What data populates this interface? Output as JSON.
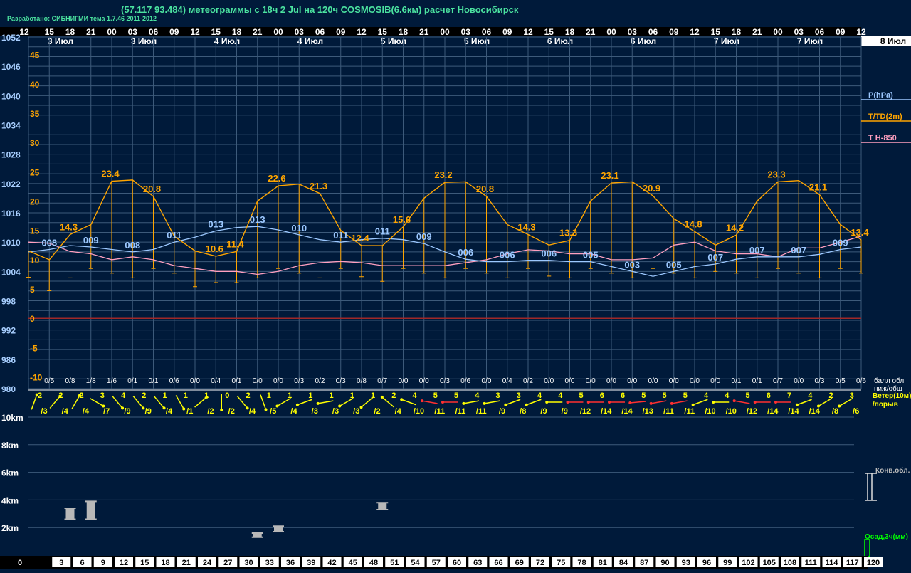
{
  "header": {
    "title": "(57.117 93.484) метеограммы с  18ч 2 Jul на 120ч COSMOSIB(6.6км) расчет Новосибирск",
    "subtitle": "Разработано: СИБНИГМИ тема 1.7.46 2011-2012"
  },
  "colors": {
    "background": "#001a3a",
    "grid": "#3d5a7a",
    "pressure": "#9cc8ff",
    "temperature": "#ffa500",
    "t850": "#ffa0c0",
    "wind": "#ffff00",
    "wind_strong": "#ff3030",
    "zero_line": "#a02828",
    "cloud": "#b8b8b8",
    "precip": "#00ff00"
  },
  "legend": {
    "pressure": "P(hPa)",
    "temperature": "T/TD(2m)",
    "t850": "T H-850",
    "cloud_label_1": "балл обл.",
    "cloud_label_2": "ниж/общ",
    "wind_label_1": "Ветер(10м)",
    "wind_label_2": "/порыв",
    "conv_cloud": "Конв.обл.",
    "precip": "Осад,3ч(мм)"
  },
  "chart_data": {
    "type": "line",
    "time_hours_labels": [
      "12",
      "15",
      "18",
      "21",
      "00",
      "03",
      "06",
      "09",
      "12",
      "15",
      "18",
      "21",
      "00",
      "03",
      "06",
      "09",
      "12",
      "15",
      "18",
      "21",
      "00",
      "03",
      "06",
      "09",
      "12",
      "15",
      "18",
      "21",
      "00",
      "03",
      "06",
      "09",
      "12",
      "15",
      "18",
      "21",
      "00",
      "03",
      "06",
      "09",
      "12"
    ],
    "date_labels": [
      "3 Июл",
      "3 Июл",
      "4 Июл",
      "4 Июл",
      "5 Июл",
      "5 Июл",
      "6 Июл",
      "6 Июл",
      "7 Июл",
      "7 Июл",
      "8 Июл"
    ],
    "forecast_hours": [
      "0",
      "3",
      "6",
      "9",
      "12",
      "15",
      "18",
      "21",
      "24",
      "27",
      "30",
      "33",
      "36",
      "39",
      "42",
      "45",
      "48",
      "51",
      "54",
      "57",
      "60",
      "63",
      "66",
      "69",
      "72",
      "75",
      "78",
      "81",
      "84",
      "87",
      "90",
      "93",
      "96",
      "99",
      "102",
      "105",
      "108",
      "111",
      "114",
      "117",
      "120"
    ],
    "pressure_axis_ticks": [
      "1052",
      "1046",
      "1040",
      "1034",
      "1028",
      "1022",
      "1016",
      "1010",
      "1004",
      "998",
      "992",
      "986",
      "980"
    ],
    "temperature_axis_ticks": [
      "45",
      "40",
      "35",
      "30",
      "25",
      "20",
      "15",
      "10",
      "5",
      "0",
      "-5",
      "-10"
    ],
    "pressure_ylim": [
      980,
      1052
    ],
    "temperature_ylim": [
      -12,
      48
    ],
    "series": [
      {
        "name": "P(hPa)",
        "values": [
          1008,
          1008.5,
          1009.3,
          1009,
          1008.5,
          1008,
          1008.5,
          1010,
          1011,
          1012.3,
          1013,
          1013.2,
          1012.5,
          1011.5,
          1010.5,
          1010,
          1010.5,
          1010.8,
          1010.5,
          1009.7,
          1008,
          1006.5,
          1006,
          1006,
          1006.3,
          1006.3,
          1006,
          1006,
          1005,
          1004,
          1003,
          1004,
          1005,
          1005.5,
          1006.5,
          1007,
          1007,
          1007,
          1007.5,
          1008.5,
          1009
        ]
      },
      {
        "name": "T/TD(2m)",
        "values": [
          11.5,
          10,
          14.3,
          16,
          23.4,
          23.6,
          20.8,
          14,
          11.5,
          10.6,
          11.4,
          20,
          22.6,
          22.9,
          21.3,
          15,
          12.4,
          12.4,
          15.6,
          20.5,
          23.2,
          23.3,
          20.8,
          16,
          14.3,
          12.5,
          13.3,
          20,
          23.1,
          23.3,
          20.9,
          17,
          14.8,
          12.5,
          14.2,
          20,
          23.3,
          23.5,
          21.1,
          16,
          13.4
        ]
      },
      {
        "name": "T H-850",
        "values": [
          13,
          12.8,
          11.4,
          11,
          10,
          10.5,
          10,
          9,
          8.5,
          8,
          8,
          7.5,
          8,
          9,
          9.5,
          9.7,
          9.5,
          9,
          9,
          9,
          9,
          9.5,
          10,
          11,
          11.7,
          11.5,
          11,
          11,
          10,
          10,
          10.3,
          12.5,
          13,
          11.5,
          11,
          11,
          10.5,
          12,
          12,
          13,
          14
        ]
      }
    ],
    "temperature_labels": [
      {
        "h": 6,
        "text": "14.3"
      },
      {
        "h": 12,
        "text": "23.4"
      },
      {
        "h": 18,
        "text": "20.8"
      },
      {
        "h": 27,
        "text": "10.6"
      },
      {
        "h": 30,
        "text": "11.4"
      },
      {
        "h": 36,
        "text": "22.6"
      },
      {
        "h": 42,
        "text": "21.3"
      },
      {
        "h": 48,
        "text": "12.4"
      },
      {
        "h": 54,
        "text": "15.6"
      },
      {
        "h": 60,
        "text": "23.2"
      },
      {
        "h": 66,
        "text": "20.8"
      },
      {
        "h": 72,
        "text": "14.3"
      },
      {
        "h": 78,
        "text": "13.3"
      },
      {
        "h": 84,
        "text": "23.1"
      },
      {
        "h": 90,
        "text": "20.9"
      },
      {
        "h": 96,
        "text": "14.8"
      },
      {
        "h": 102,
        "text": "14.2"
      },
      {
        "h": 108,
        "text": "23.3"
      },
      {
        "h": 114,
        "text": "21.1"
      },
      {
        "h": 120,
        "text": "13.4"
      }
    ],
    "pressure_labels": [
      {
        "h": 3,
        "text": "008"
      },
      {
        "h": 9,
        "text": "009"
      },
      {
        "h": 15,
        "text": "008"
      },
      {
        "h": 21,
        "text": "011"
      },
      {
        "h": 27,
        "text": "013"
      },
      {
        "h": 33,
        "text": "013"
      },
      {
        "h": 39,
        "text": "010"
      },
      {
        "h": 45,
        "text": "011"
      },
      {
        "h": 51,
        "text": "011"
      },
      {
        "h": 57,
        "text": "009"
      },
      {
        "h": 63,
        "text": "006"
      },
      {
        "h": 69,
        "text": "006"
      },
      {
        "h": 75,
        "text": "006"
      },
      {
        "h": 81,
        "text": "005"
      },
      {
        "h": 87,
        "text": "003"
      },
      {
        "h": 93,
        "text": "005"
      },
      {
        "h": 99,
        "text": "007"
      },
      {
        "h": 105,
        "text": "007"
      },
      {
        "h": 111,
        "text": "007"
      },
      {
        "h": 117,
        "text": "009"
      }
    ],
    "cloud_cover": [
      "0/5",
      "0/8",
      "1/8",
      "1/6",
      "0/1",
      "0/1",
      "0/6",
      "0/0",
      "0/4",
      "0/1",
      "0/0",
      "0/0",
      "0/3",
      "0/2",
      "0/3",
      "0/8",
      "0/7",
      "0/0",
      "0/0",
      "0/3",
      "0/6",
      "0/0",
      "0/4",
      "0/2",
      "0/0",
      "0/0",
      "0/0",
      "0/0",
      "0/0",
      "0/0",
      "0/0",
      "0/0",
      "0/0",
      "0/1",
      "0/1",
      "0/7",
      "0/0",
      "0/3",
      "0/5",
      "0/6"
    ],
    "wind": [
      {
        "speed": "2",
        "gust": "/3",
        "dir": 200
      },
      {
        "speed": "2",
        "gust": "/4",
        "dir": 220
      },
      {
        "speed": "2",
        "gust": "/4",
        "dir": 210
      },
      {
        "speed": "3",
        "gust": "/7",
        "dir": 300
      },
      {
        "speed": "4",
        "gust": "/9",
        "dir": 320
      },
      {
        "speed": "2",
        "gust": "/9",
        "dir": 320
      },
      {
        "speed": "1",
        "gust": "/4",
        "dir": 320
      },
      {
        "speed": "1",
        "gust": "/1",
        "dir": 330
      },
      {
        "speed": "1",
        "gust": "/2",
        "dir": 230
      },
      {
        "speed": "0",
        "gust": "/2",
        "dir": 0
      },
      {
        "speed": "2",
        "gust": "/4",
        "dir": 320
      },
      {
        "speed": "1",
        "gust": "/5",
        "dir": 340
      },
      {
        "speed": "1",
        "gust": "/4",
        "dir": 60
      },
      {
        "speed": "1",
        "gust": "/3",
        "dir": 70
      },
      {
        "speed": "1",
        "gust": "/3",
        "dir": 80
      },
      {
        "speed": "1",
        "gust": "/3",
        "dir": 60
      },
      {
        "speed": "1",
        "gust": "/2",
        "dir": 50
      },
      {
        "speed": "2",
        "gust": "/4",
        "dir": 130
      },
      {
        "speed": "4",
        "gust": "/10",
        "dir": 110
      },
      {
        "speed": "5",
        "gust": "/11",
        "dir": 100
      },
      {
        "speed": "5",
        "gust": "/11",
        "dir": 90
      },
      {
        "speed": "4",
        "gust": "/11",
        "dir": 80
      },
      {
        "speed": "3",
        "gust": "/9",
        "dir": 80
      },
      {
        "speed": "3",
        "gust": "/8",
        "dir": 70
      },
      {
        "speed": "4",
        "gust": "/9",
        "dir": 70
      },
      {
        "speed": "4",
        "gust": "/9",
        "dir": 90
      },
      {
        "speed": "5",
        "gust": "/12",
        "dir": 90
      },
      {
        "speed": "6",
        "gust": "/14",
        "dir": 90
      },
      {
        "speed": "6",
        "gust": "/14",
        "dir": 90
      },
      {
        "speed": "5",
        "gust": "/13",
        "dir": 85
      },
      {
        "speed": "5",
        "gust": "/11",
        "dir": 80
      },
      {
        "speed": "5",
        "gust": "/11",
        "dir": 80
      },
      {
        "speed": "4",
        "gust": "/10",
        "dir": 70
      },
      {
        "speed": "4",
        "gust": "/10",
        "dir": 90
      },
      {
        "speed": "5",
        "gust": "/12",
        "dir": 100
      },
      {
        "speed": "6",
        "gust": "/14",
        "dir": 90
      },
      {
        "speed": "7",
        "gust": "/14",
        "dir": 90
      },
      {
        "speed": "4",
        "gust": "/14",
        "dir": 70
      },
      {
        "speed": "2",
        "gust": "/8",
        "dir": 60
      },
      {
        "speed": "3",
        "gust": "/6",
        "dir": 60
      }
    ],
    "wind_strong_threshold": 5,
    "cloud_height_axis_ticks": [
      "10km",
      "8km",
      "6km",
      "4km",
      "2km"
    ],
    "cloud_height_ylim_km": [
      0,
      10
    ],
    "convective_clouds": [
      {
        "h": 6,
        "base_km": 2.6,
        "top_km": 3.4
      },
      {
        "h": 9,
        "base_km": 2.6,
        "top_km": 3.9
      },
      {
        "h": 33,
        "base_km": 1.3,
        "top_km": 1.6
      },
      {
        "h": 36,
        "base_km": 1.7,
        "top_km": 2.1
      },
      {
        "h": 51,
        "base_km": 3.3,
        "top_km": 3.8
      }
    ],
    "legend_placement": "right",
    "grid": true
  }
}
